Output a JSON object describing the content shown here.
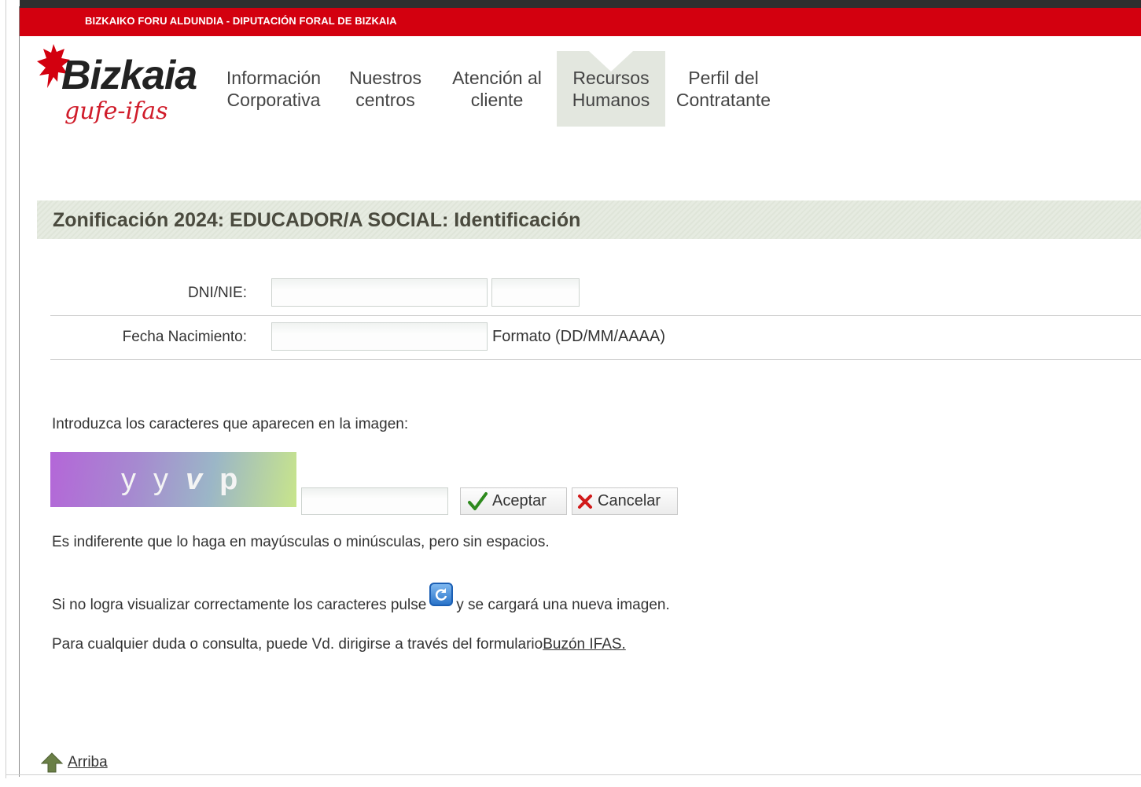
{
  "header": {
    "banner_text": "BIZKAIKO FORU ALDUNDIA - DIPUTACIÓN FORAL DE BIZKAIA",
    "logo_word": "Bizkaia",
    "logo_sub": "gufe-ifas"
  },
  "nav": {
    "items": [
      {
        "label": "Información\nCorporativa",
        "active": false
      },
      {
        "label": "Nuestros\ncentros",
        "active": false
      },
      {
        "label": "Atención al\ncliente",
        "active": false
      },
      {
        "label": "Recursos\nHumanos",
        "active": true
      },
      {
        "label": "Perfil del\nContratante",
        "active": false
      }
    ]
  },
  "page": {
    "title": "Zonificación 2024: EDUCADOR/A SOCIAL: Identificación"
  },
  "form": {
    "dni_label": "DNI/NIE:",
    "dni_value": "",
    "dni_letter_value": "",
    "birth_label": "Fecha Nacimiento:",
    "birth_value": "",
    "birth_format": "Formato (DD/MM/AAAA)"
  },
  "captcha": {
    "prompt": "Introduzca los caracteres que aparecen en la imagen:",
    "chars": [
      "y",
      "y",
      "v",
      "p"
    ],
    "input_value": "",
    "accept_label": "Aceptar",
    "cancel_label": "Cancelar",
    "case_note": "Es indiferente que lo haga en mayúsculas o minúsculas, pero sin espacios.",
    "reload_before": "Si no logra visualizar correctamente los caracteres pulse",
    "reload_after": "y se cargará una nueva imagen.",
    "contact_text": "Para cualquier duda o consulta, puede Vd. dirigirse a través del formulario",
    "contact_link": "Buzón IFAS."
  },
  "footer": {
    "top_link": "Arriba"
  },
  "colors": {
    "brand_red": "#d3000f",
    "nav_active_bg": "#e3e7df",
    "title_band": "#e6ebe1"
  }
}
